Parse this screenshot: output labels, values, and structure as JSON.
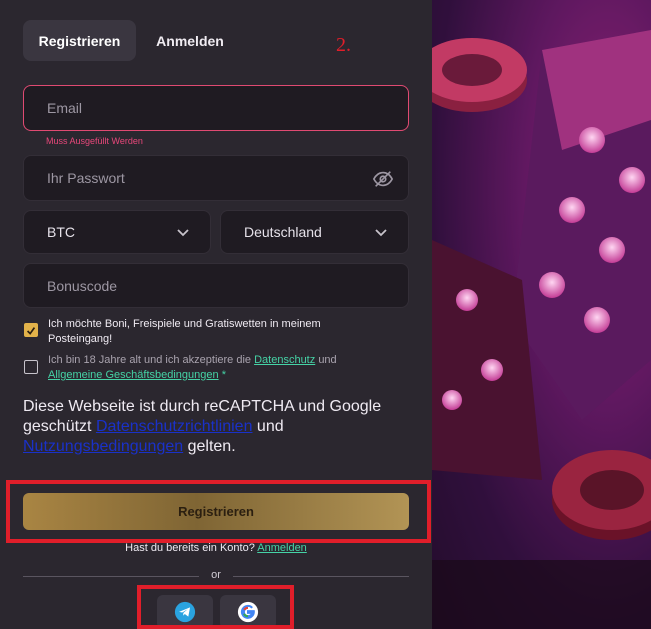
{
  "tabs": {
    "register": "Registrieren",
    "login": "Anmelden"
  },
  "annotation": {
    "step": "2."
  },
  "form": {
    "email_placeholder": "Email",
    "email_error": "Muss Ausgefüllt Werden",
    "password_placeholder": "Ihr Passwort",
    "currency": "BTC",
    "country": "Deutschland",
    "bonus_placeholder": "Bonuscode"
  },
  "checkboxes": {
    "promo_label": "Ich möchte Boni, Freispiele und Gratiswetten in meinem Posteingang!",
    "promo_checked": true,
    "age_prefix": "Ich bin 18 Jahre alt und ich akzeptiere die",
    "age_link1": "Datenschutz",
    "age_and": "und",
    "age_link2": "Allgemeine Geschäftsbedingungen",
    "age_asterisk": "*",
    "age_checked": false
  },
  "recaptcha": {
    "text1": "Diese Webseite ist durch reCAPTCHA und Google geschützt",
    "link1": "Datenschutzrichtlinien",
    "and": "und",
    "link2": "Nutzungsbedingungen",
    "text2": "gelten."
  },
  "submit_label": "Registrieren",
  "have_account": "Hast du bereits ein Konto?",
  "login_link": "Anmelden",
  "or_label": "or",
  "social": [
    "telegram-icon",
    "google-icon"
  ],
  "colors": {
    "accent_gold": "#a98543",
    "error": "#e8477a",
    "link_green": "#45d3a6",
    "annotation_red": "#e01e2a"
  }
}
